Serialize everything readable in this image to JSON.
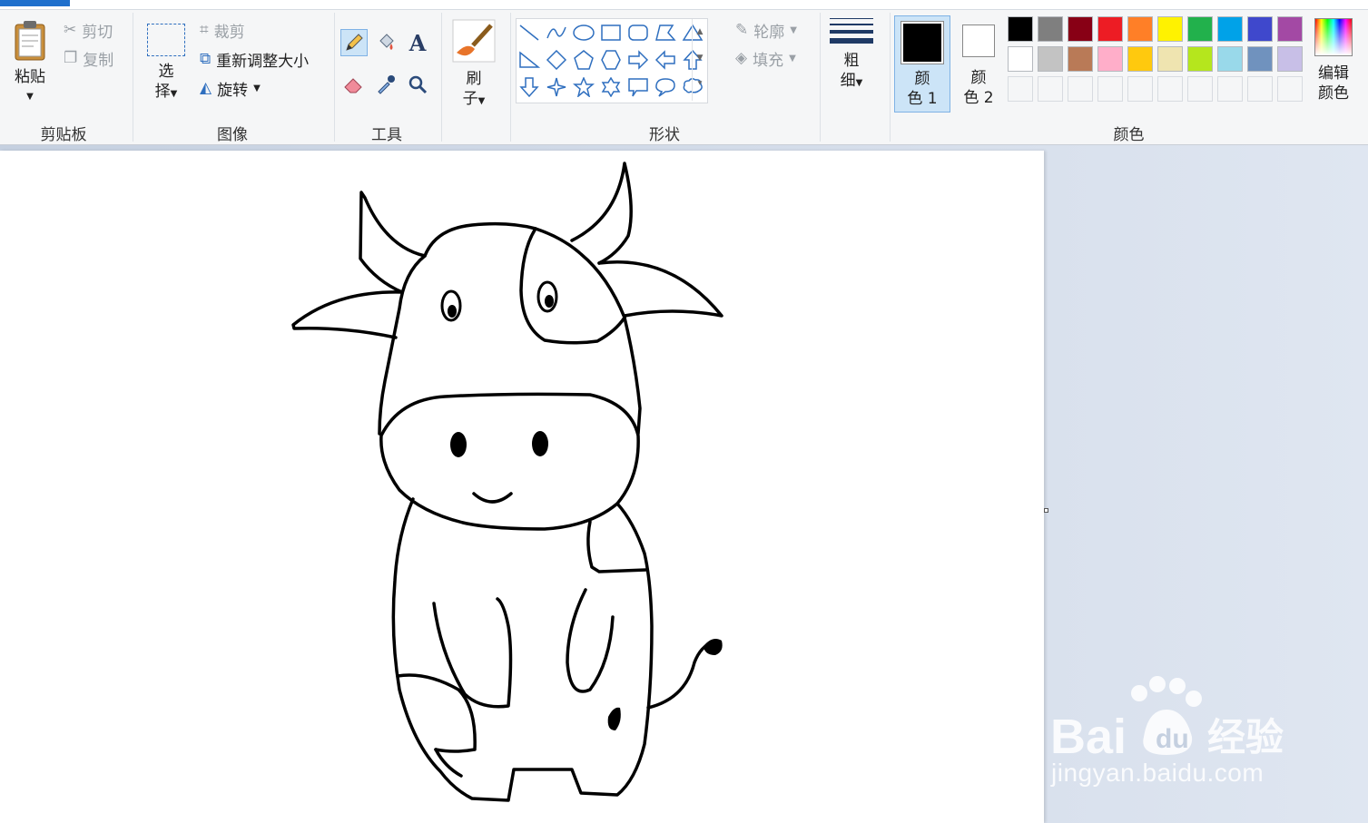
{
  "clipboard": {
    "paste_label": "粘贴",
    "cut_label": "剪切",
    "copy_label": "复制",
    "group_label": "剪贴板"
  },
  "image": {
    "select_label_1": "选",
    "select_label_2": "择",
    "crop_label": "裁剪",
    "resize_label": "重新调整大小",
    "rotate_label": "旋转",
    "group_label": "图像"
  },
  "tools": {
    "group_label": "工具",
    "icons": [
      "pencil-icon",
      "fill-icon",
      "text-icon",
      "eraser-icon",
      "color-picker-icon",
      "magnifier-icon"
    ],
    "active": "pencil"
  },
  "brushes": {
    "label_1": "刷",
    "label_2": "子"
  },
  "shapes": {
    "group_label": "形状",
    "outline_label": "轮廓",
    "fill_label": "填充"
  },
  "size": {
    "label_1": "粗",
    "label_2": "细"
  },
  "colors": {
    "group_label": "颜色",
    "color1_label_1": "颜",
    "color1_label_2": "色 1",
    "color2_label_1": "颜",
    "color2_label_2": "色 2",
    "edit_label_1": "编辑",
    "edit_label_2": "颜色",
    "color1": "#000000",
    "color2": "#ffffff",
    "palette_row1": [
      "#000000",
      "#7f7f7f",
      "#880015",
      "#ed1c24",
      "#ff7f27",
      "#fff200",
      "#22b14c",
      "#00a2e8",
      "#3f48cc",
      "#a349a4"
    ],
    "palette_row2": [
      "#ffffff",
      "#c3c3c3",
      "#b97a57",
      "#ffaec9",
      "#ffc90e",
      "#efe4b0",
      "#b5e61d",
      "#99d9ea",
      "#7092be",
      "#c8bfe7"
    ]
  },
  "watermark": {
    "url": "jingyan.baidu.com",
    "brand": "Bai",
    "brand2": "经验"
  }
}
